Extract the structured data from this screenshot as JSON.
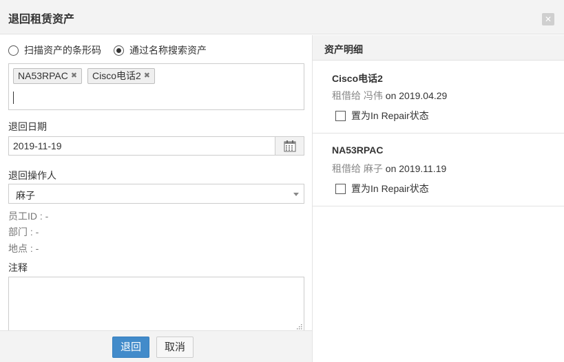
{
  "dialog": {
    "title": "退回租赁资产",
    "close_icon": "close-icon"
  },
  "left": {
    "radio_options": [
      {
        "label": "扫描资产的条形码",
        "selected": false
      },
      {
        "label": "通过名称搜索资产",
        "selected": true
      }
    ],
    "tags": [
      {
        "label": "NA53RPAC"
      },
      {
        "label": "Cisco电话2"
      }
    ],
    "return_date": {
      "label": "退回日期",
      "value": "2019-11-19",
      "icon": "calendar-icon"
    },
    "operator": {
      "label": "退回操作人",
      "value": "麻子"
    },
    "employee_id": "员工ID : -",
    "department": "部门 : -",
    "location": "地点 : -",
    "notes": {
      "label": "注释",
      "value": ""
    },
    "buttons": {
      "return": "退回",
      "cancel": "取消"
    }
  },
  "right": {
    "title": "资产明细",
    "assets": [
      {
        "name": "Cisco电话2",
        "leased_to_prefix": "租借给 冯伟",
        "leased_on": "on 2019.04.29",
        "repair_label": "置为In Repair状态",
        "repair_checked": false
      },
      {
        "name": "NA53RPAC",
        "leased_to_prefix": "租借给 麻子",
        "leased_on": "on 2019.11.19",
        "repair_label": "置为In Repair状态",
        "repair_checked": false
      }
    ]
  },
  "colors": {
    "primary": "#428bca",
    "header_bg": "#f3f3f3",
    "border": "#cccccc"
  }
}
